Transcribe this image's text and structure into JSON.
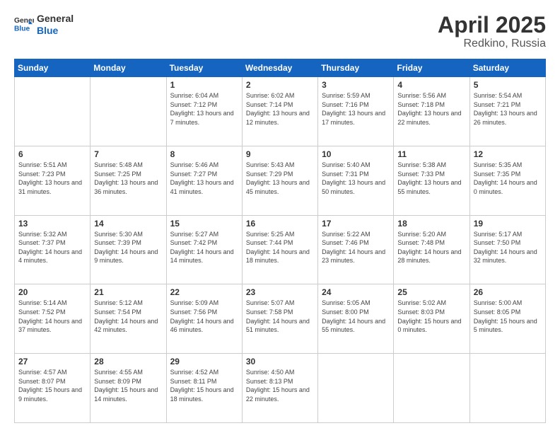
{
  "header": {
    "logo_general": "General",
    "logo_blue": "Blue",
    "month": "April 2025",
    "location": "Redkino, Russia"
  },
  "days_of_week": [
    "Sunday",
    "Monday",
    "Tuesday",
    "Wednesday",
    "Thursday",
    "Friday",
    "Saturday"
  ],
  "weeks": [
    [
      {
        "day": "",
        "info": ""
      },
      {
        "day": "",
        "info": ""
      },
      {
        "day": "1",
        "info": "Sunrise: 6:04 AM\nSunset: 7:12 PM\nDaylight: 13 hours and 7 minutes."
      },
      {
        "day": "2",
        "info": "Sunrise: 6:02 AM\nSunset: 7:14 PM\nDaylight: 13 hours and 12 minutes."
      },
      {
        "day": "3",
        "info": "Sunrise: 5:59 AM\nSunset: 7:16 PM\nDaylight: 13 hours and 17 minutes."
      },
      {
        "day": "4",
        "info": "Sunrise: 5:56 AM\nSunset: 7:18 PM\nDaylight: 13 hours and 22 minutes."
      },
      {
        "day": "5",
        "info": "Sunrise: 5:54 AM\nSunset: 7:21 PM\nDaylight: 13 hours and 26 minutes."
      }
    ],
    [
      {
        "day": "6",
        "info": "Sunrise: 5:51 AM\nSunset: 7:23 PM\nDaylight: 13 hours and 31 minutes."
      },
      {
        "day": "7",
        "info": "Sunrise: 5:48 AM\nSunset: 7:25 PM\nDaylight: 13 hours and 36 minutes."
      },
      {
        "day": "8",
        "info": "Sunrise: 5:46 AM\nSunset: 7:27 PM\nDaylight: 13 hours and 41 minutes."
      },
      {
        "day": "9",
        "info": "Sunrise: 5:43 AM\nSunset: 7:29 PM\nDaylight: 13 hours and 45 minutes."
      },
      {
        "day": "10",
        "info": "Sunrise: 5:40 AM\nSunset: 7:31 PM\nDaylight: 13 hours and 50 minutes."
      },
      {
        "day": "11",
        "info": "Sunrise: 5:38 AM\nSunset: 7:33 PM\nDaylight: 13 hours and 55 minutes."
      },
      {
        "day": "12",
        "info": "Sunrise: 5:35 AM\nSunset: 7:35 PM\nDaylight: 14 hours and 0 minutes."
      }
    ],
    [
      {
        "day": "13",
        "info": "Sunrise: 5:32 AM\nSunset: 7:37 PM\nDaylight: 14 hours and 4 minutes."
      },
      {
        "day": "14",
        "info": "Sunrise: 5:30 AM\nSunset: 7:39 PM\nDaylight: 14 hours and 9 minutes."
      },
      {
        "day": "15",
        "info": "Sunrise: 5:27 AM\nSunset: 7:42 PM\nDaylight: 14 hours and 14 minutes."
      },
      {
        "day": "16",
        "info": "Sunrise: 5:25 AM\nSunset: 7:44 PM\nDaylight: 14 hours and 18 minutes."
      },
      {
        "day": "17",
        "info": "Sunrise: 5:22 AM\nSunset: 7:46 PM\nDaylight: 14 hours and 23 minutes."
      },
      {
        "day": "18",
        "info": "Sunrise: 5:20 AM\nSunset: 7:48 PM\nDaylight: 14 hours and 28 minutes."
      },
      {
        "day": "19",
        "info": "Sunrise: 5:17 AM\nSunset: 7:50 PM\nDaylight: 14 hours and 32 minutes."
      }
    ],
    [
      {
        "day": "20",
        "info": "Sunrise: 5:14 AM\nSunset: 7:52 PM\nDaylight: 14 hours and 37 minutes."
      },
      {
        "day": "21",
        "info": "Sunrise: 5:12 AM\nSunset: 7:54 PM\nDaylight: 14 hours and 42 minutes."
      },
      {
        "day": "22",
        "info": "Sunrise: 5:09 AM\nSunset: 7:56 PM\nDaylight: 14 hours and 46 minutes."
      },
      {
        "day": "23",
        "info": "Sunrise: 5:07 AM\nSunset: 7:58 PM\nDaylight: 14 hours and 51 minutes."
      },
      {
        "day": "24",
        "info": "Sunrise: 5:05 AM\nSunset: 8:00 PM\nDaylight: 14 hours and 55 minutes."
      },
      {
        "day": "25",
        "info": "Sunrise: 5:02 AM\nSunset: 8:03 PM\nDaylight: 15 hours and 0 minutes."
      },
      {
        "day": "26",
        "info": "Sunrise: 5:00 AM\nSunset: 8:05 PM\nDaylight: 15 hours and 5 minutes."
      }
    ],
    [
      {
        "day": "27",
        "info": "Sunrise: 4:57 AM\nSunset: 8:07 PM\nDaylight: 15 hours and 9 minutes."
      },
      {
        "day": "28",
        "info": "Sunrise: 4:55 AM\nSunset: 8:09 PM\nDaylight: 15 hours and 14 minutes."
      },
      {
        "day": "29",
        "info": "Sunrise: 4:52 AM\nSunset: 8:11 PM\nDaylight: 15 hours and 18 minutes."
      },
      {
        "day": "30",
        "info": "Sunrise: 4:50 AM\nSunset: 8:13 PM\nDaylight: 15 hours and 22 minutes."
      },
      {
        "day": "",
        "info": ""
      },
      {
        "day": "",
        "info": ""
      },
      {
        "day": "",
        "info": ""
      }
    ]
  ]
}
